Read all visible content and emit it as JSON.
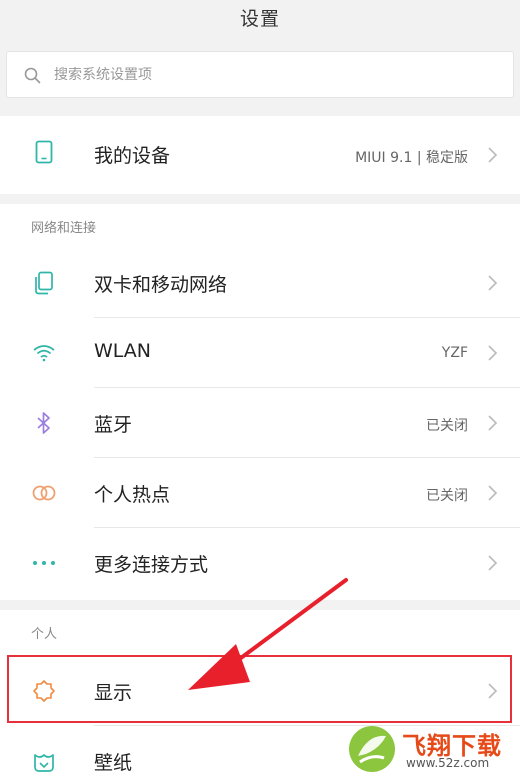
{
  "header": {
    "title": "设置"
  },
  "search": {
    "placeholder": "搜索系统设置项",
    "icon": "search-icon"
  },
  "device": {
    "label": "我的设备",
    "value": "MIUI 9.1 | 稳定版",
    "icon": "phone-icon"
  },
  "sections": {
    "network_title": "网络和连接",
    "personal_title": "个人"
  },
  "network_items": [
    {
      "label": "双卡和移动网络",
      "value": "",
      "icon": "sim-card-icon"
    },
    {
      "label": "WLAN",
      "value": "YZF",
      "icon": "wifi-icon"
    },
    {
      "label": "蓝牙",
      "value": "已关闭",
      "icon": "bluetooth-icon"
    },
    {
      "label": "个人热点",
      "value": "已关闭",
      "icon": "hotspot-icon"
    },
    {
      "label": "更多连接方式",
      "value": "",
      "icon": "more-dots-icon"
    }
  ],
  "personal_items": [
    {
      "label": "显示",
      "value": "",
      "icon": "brightness-icon"
    },
    {
      "label": "壁纸",
      "value": "",
      "icon": "wallpaper-icon"
    }
  ],
  "watermark": {
    "brand": "飞翔下载",
    "url": "www.52z.com"
  },
  "colors": {
    "accent_teal": "#2fb6a8",
    "bluetooth_purple": "#9b7ee0",
    "hotspot_orange": "#f0a070",
    "display_orange": "#f08a40",
    "highlight_red": "#e8303c"
  }
}
